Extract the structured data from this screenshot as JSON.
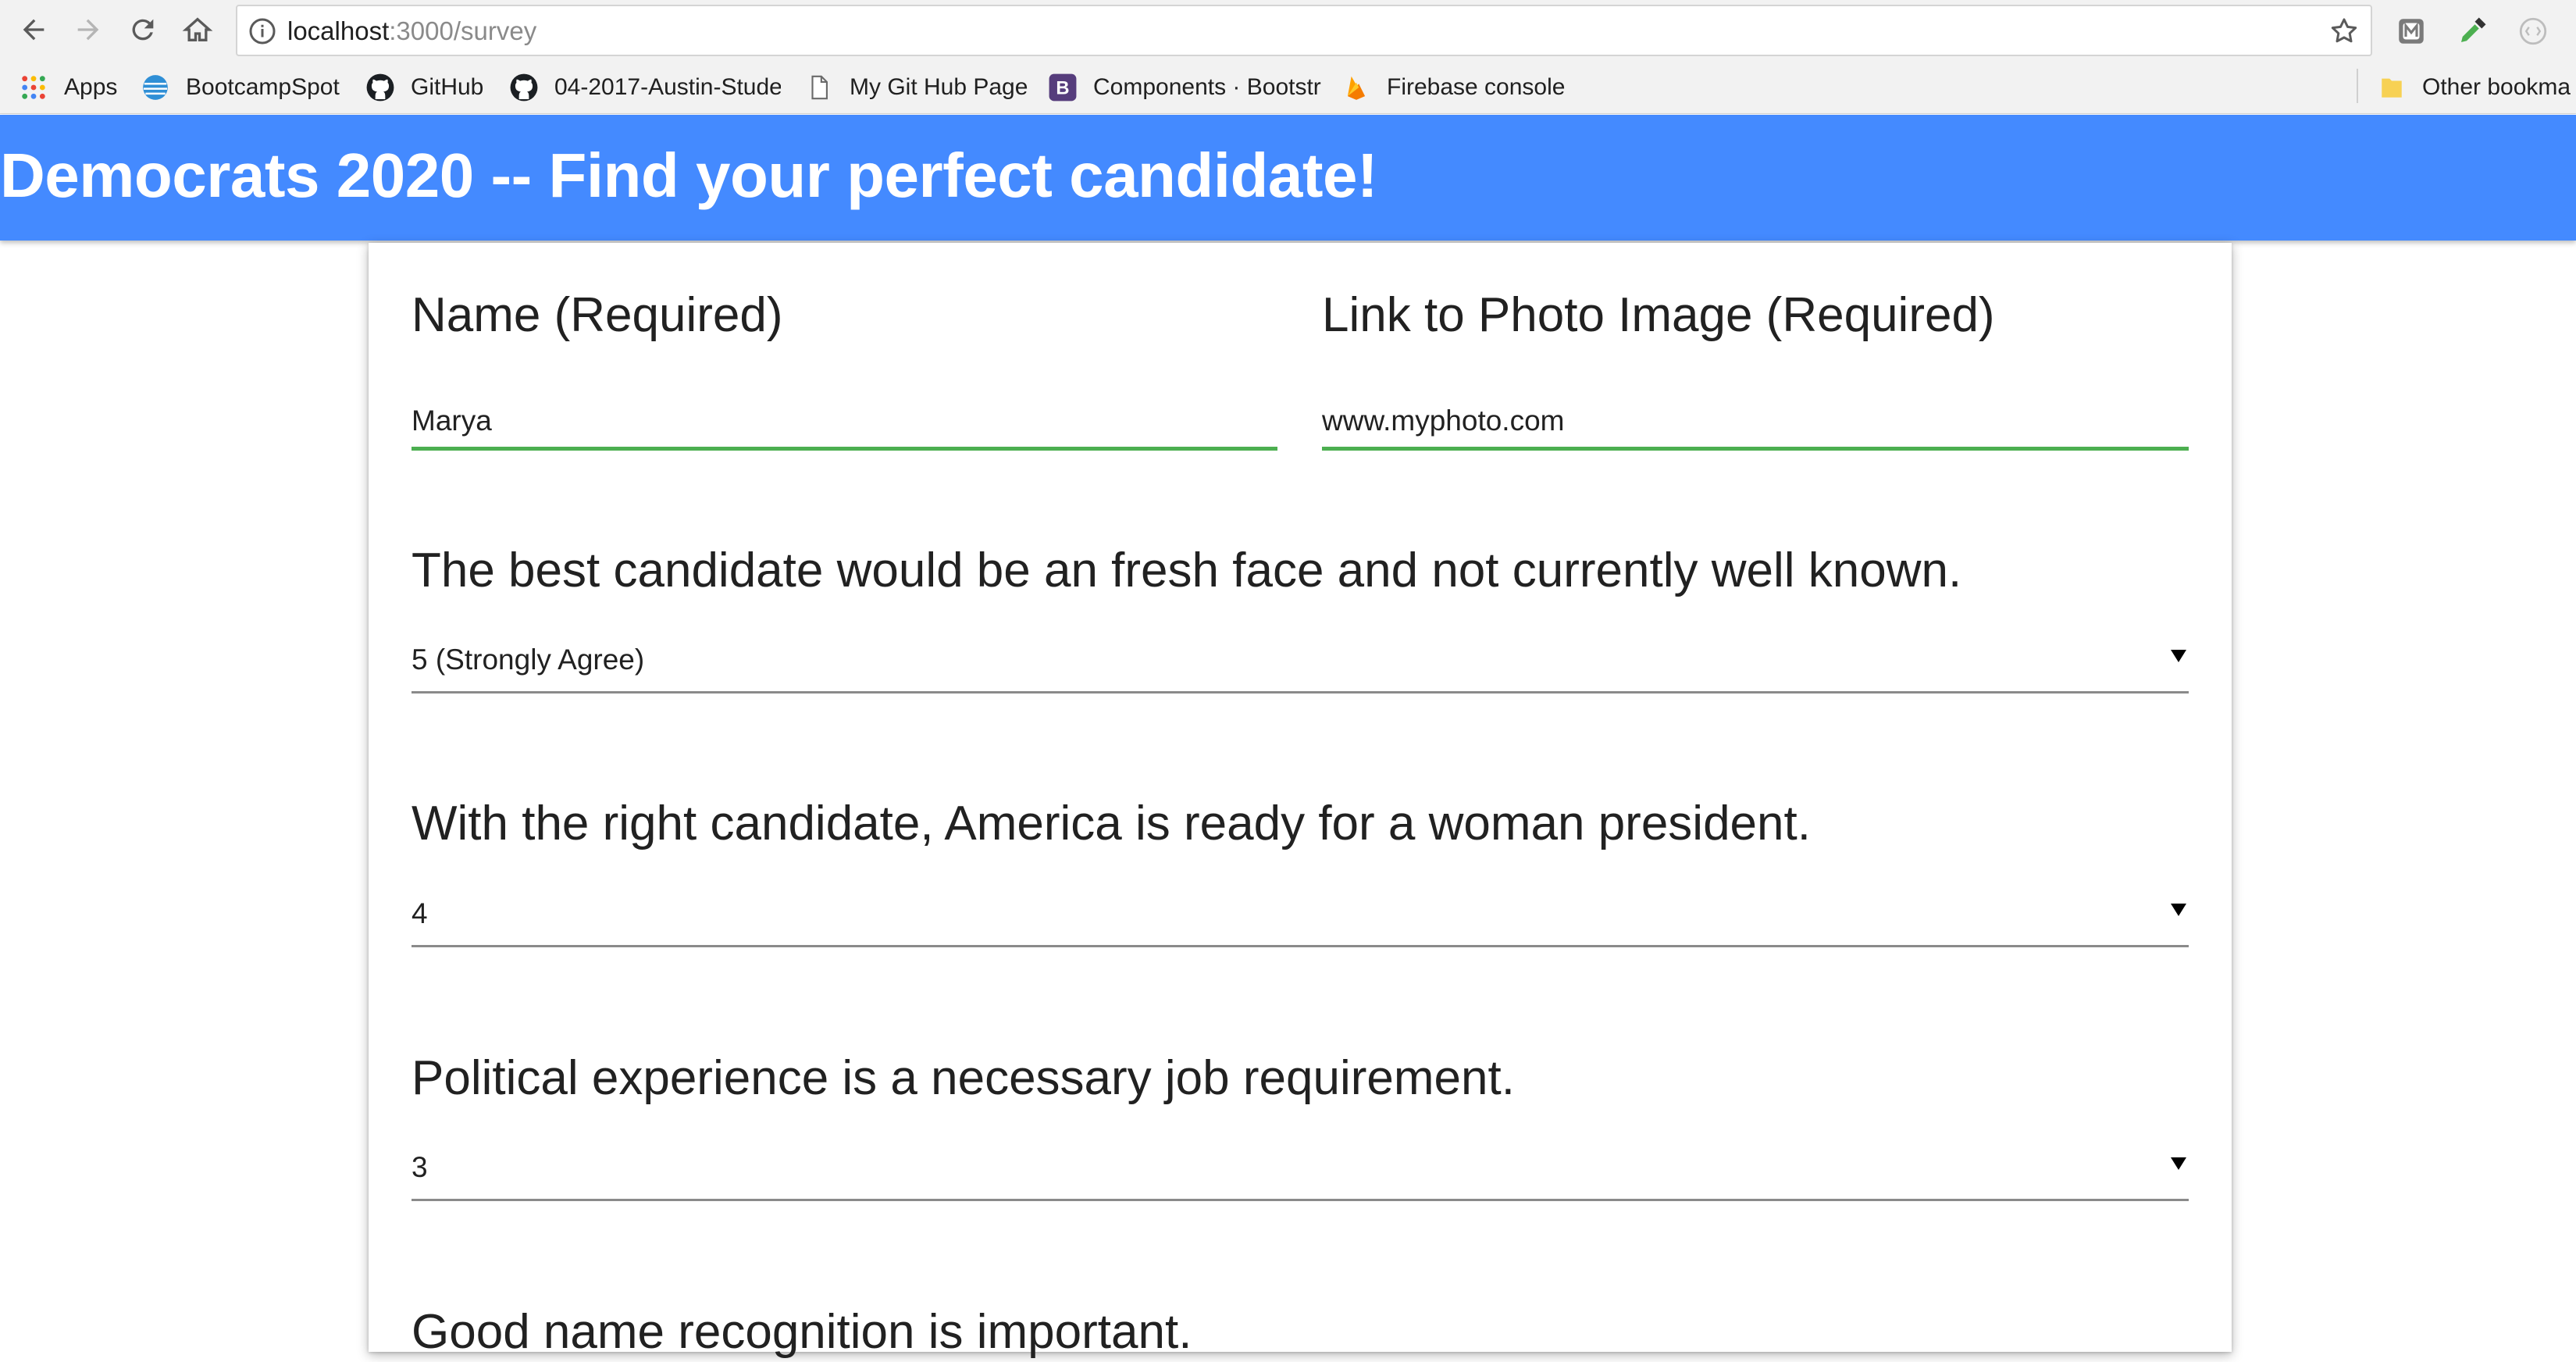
{
  "browser": {
    "url_host": "localhost",
    "url_path": ":3000/survey",
    "bookmarks": [
      {
        "label": "Apps",
        "icon": "apps-grid-icon"
      },
      {
        "label": "BootcampSpot",
        "icon": "att-globe-icon"
      },
      {
        "label": "GitHub",
        "icon": "github-icon"
      },
      {
        "label": "04-2017-Austin-Stude",
        "icon": "github-icon"
      },
      {
        "label": "My Git Hub Page",
        "icon": "page-icon"
      },
      {
        "label": "Components · Bootstr",
        "icon": "bootstrap-icon"
      },
      {
        "label": "Firebase console",
        "icon": "firebase-icon"
      },
      {
        "label": "Other bookma",
        "icon": "folder-icon"
      }
    ]
  },
  "header": {
    "title": "Democrats 2020 -- Find your perfect candidate!",
    "color": "#448aff"
  },
  "form": {
    "name_label": "Name (Required)",
    "name_value": "Marya",
    "photo_label": "Link to Photo Image (Required)",
    "photo_value": "www.myphoto.com",
    "valid_color": "#4caf50",
    "questions": [
      {
        "text": "The best candidate would be an fresh face and not currently well known.",
        "selected": "5 (Strongly Agree)"
      },
      {
        "text": "With the right candidate, America is ready for a woman president.",
        "selected": "4"
      },
      {
        "text": "Political experience is a necessary job requirement.",
        "selected": "3"
      },
      {
        "text": "Good name recognition is important."
      }
    ]
  }
}
